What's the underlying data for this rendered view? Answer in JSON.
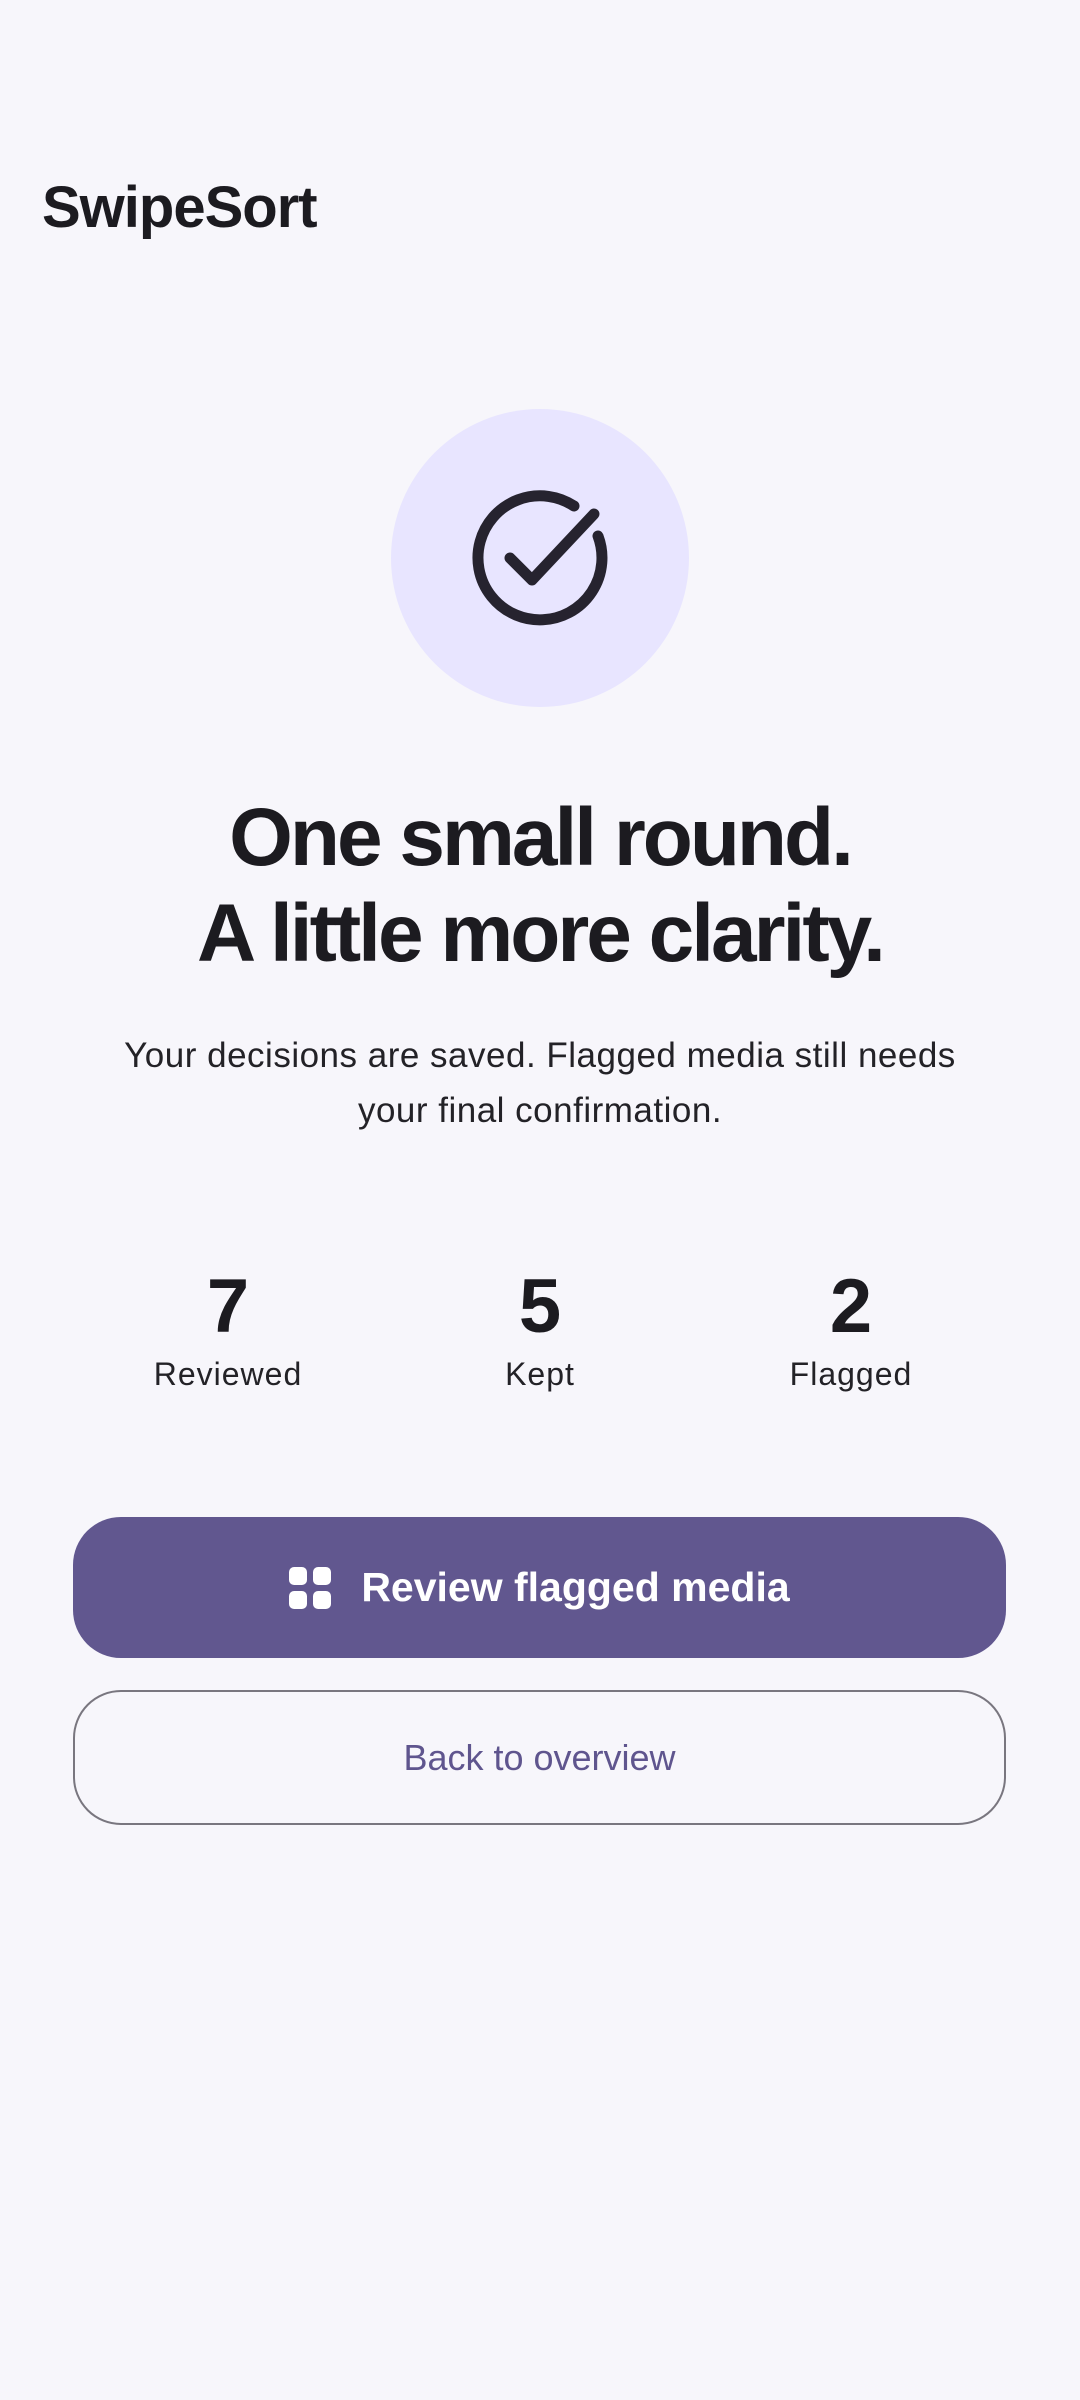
{
  "header": {
    "app_title": "SwipeSort"
  },
  "hero": {
    "icon": "check-circle-icon",
    "circle_color": "#e8e5ff"
  },
  "headline": {
    "line1": "One small round.",
    "line2": "A little more clarity."
  },
  "subtitle": "Your decisions are saved. Flagged media still needs your final confirmation.",
  "stats": [
    {
      "value": "7",
      "label": "Reviewed"
    },
    {
      "value": "5",
      "label": "Kept"
    },
    {
      "value": "2",
      "label": "Flagged"
    }
  ],
  "actions": {
    "primary_label": "Review flagged media",
    "primary_icon": "grid-icon",
    "primary_color": "#61578f",
    "secondary_label": "Back to overview"
  }
}
